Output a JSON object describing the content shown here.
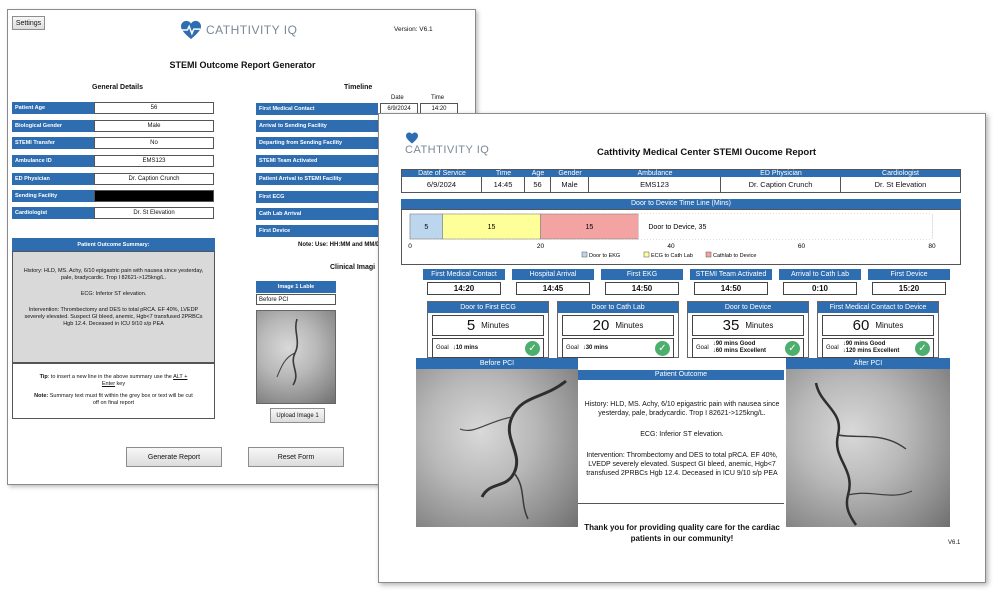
{
  "form": {
    "settings_label": "Settings",
    "brand": "CATHTIVITY IQ",
    "version": "Version: V6.1",
    "title": "STEMI Outcome Report Generator",
    "general_heading": "General Details",
    "timeline_heading": "Timeline",
    "timeline_cols": [
      "Date",
      "Time"
    ],
    "timeline_first_values": [
      "6/9/2024",
      "14:20"
    ],
    "fields": [
      {
        "label": "Patient Age",
        "value": "56"
      },
      {
        "label": "Biological Gender",
        "value": "Male"
      },
      {
        "label": "STEMI Transfer",
        "value": "No"
      },
      {
        "label": "Ambulance ID",
        "value": "EMS123"
      },
      {
        "label": "ED Physician",
        "value": "Dr. Caption Crunch"
      },
      {
        "label": "Sending Facility",
        "value": ""
      },
      {
        "label": "Cardiologist",
        "value": "Dr. St Elevation"
      }
    ],
    "timeline_items": [
      "First Medical Contact",
      "Arrival to Sending Facility",
      "Departing from Sending Facility",
      "STEMI Team Activated",
      "Patient Arrival to STEMI Facility",
      "First ECG",
      "Cath Lab Arrival",
      "First Device"
    ],
    "timeline_note": "Note: Use: HH:MM and MM/D",
    "summary_heading": "Patient Outcome Summary:",
    "summary_lines": [
      "History: HLD, MS. Achy, 6/10 epigastric pain with nausea since yesterday, pale, bradycardic. Trop I 82621->125kng/L.",
      "ECG: Inferior ST elevation.",
      "Intervention: Thrombectomy and DES to total pRCA.  EF 40%, LVEDP severely elevated.  Suspect GI bleed, anemic, Hgb<7 transfused 2PRBCs Hgb 12.4.  Deceased in ICU 9/10 s/p PEA"
    ],
    "tip_prefix": "Tip",
    "tip_text": ": to insert a new line in the above summary use the ",
    "tip_key": "ALT + Enter",
    "tip_suffix": " key",
    "note_prefix": "Note:",
    "note_text": " Summary text must fit within the grey box or text will be cut off on final report",
    "clinical_heading": "Clinical Imagi",
    "image_label_heading": "Image 1 Lable",
    "image_label_value": "Before PCI",
    "upload_button": "Upload Image 1",
    "generate_button": "Generate Report",
    "reset_button": "Reset Form"
  },
  "report": {
    "brand": "CATHTIVITY IQ",
    "title": "Cathtivity Medical Center STEMI Oucome Report",
    "info_headers": [
      "Date of Service",
      "Time",
      "Age",
      "Gender",
      "Ambulance",
      "ED Physician",
      "Cardiologist"
    ],
    "info_values": [
      "6/9/2024",
      "14:45",
      "56",
      "Male",
      "EMS123",
      "Dr. Caption Crunch",
      "Dr. St Elevation"
    ],
    "timeline_title": "Door to Device Time Line (Mins)",
    "segments": [
      {
        "label": "5",
        "value": 5,
        "color": "#bcd6ee"
      },
      {
        "label": "15",
        "value": 15,
        "color": "#ffff99"
      },
      {
        "label": "15",
        "value": 15,
        "color": "#f4a3a3"
      },
      {
        "label": "Door to Device, 35",
        "value": 45,
        "color": "#ffffff"
      }
    ],
    "axis_max": 80,
    "axis_ticks": [
      "0",
      "20",
      "40",
      "60",
      "80"
    ],
    "legend": [
      {
        "label": "Door to EKG",
        "color": "#bcd6ee"
      },
      {
        "label": "ECG to Cath Lab",
        "color": "#ffff99"
      },
      {
        "label": "Cathlab to Device",
        "color": "#f4a3a3"
      }
    ],
    "kpis": [
      {
        "label": "First Medical Contact",
        "value": "14:20"
      },
      {
        "label": "Hospital Arrival",
        "value": "14:45"
      },
      {
        "label": "First EKG",
        "value": "14:50"
      },
      {
        "label": "STEMI Team Activated",
        "value": "14:50"
      },
      {
        "label": "Arrival to Cath Lab",
        "value": "0:10"
      },
      {
        "label": "First Device",
        "value": "15:20"
      }
    ],
    "door_metrics": [
      {
        "label": "Door to First ECG",
        "value": "5",
        "unit": "Minutes",
        "goal_prefix": "Goal",
        "goal_lines": [
          "↓10 mins"
        ]
      },
      {
        "label": "Door to Cath Lab",
        "value": "20",
        "unit": "Minutes",
        "goal_prefix": "Goal",
        "goal_lines": [
          "↓30 mins"
        ]
      },
      {
        "label": "Door to Device",
        "value": "35",
        "unit": "Minutes",
        "goal_prefix": "Goal",
        "goal_lines": [
          "↓90 mins Good",
          "↓60 mins Excellent"
        ]
      },
      {
        "label": "First Medical Contact to Device",
        "value": "60",
        "unit": "Minutes",
        "goal_prefix": "Goal",
        "goal_lines": [
          "↓90 mins Good",
          "↓120 mins Excellent"
        ]
      }
    ],
    "before_label": "Before PCI",
    "after_label": "After PCI",
    "outcome_heading": "Patient Outcome",
    "outcome_lines": [
      "History: HLD, MS. Achy, 6/10 epigastric pain with nausea since yesterday, pale, bradycardic. Trop I 82621->125kng/L.",
      "ECG: Inferior ST elevation.",
      "Intervention: Thrombectomy and DES to total pRCA.  EF 40%, LVEDP severely elevated.  Suspect GI bleed, anemic, Hgb<7 transfused 2PRBCs Hgb 12.4.  Deceased in ICU 9/10 s/p PEA"
    ],
    "thanks": "Thank you for providing quality care for the cardiac patients in our community!",
    "version": "V6.1"
  },
  "colors": {
    "accent": "#2f6db1",
    "brand_heart": "#2f6db1",
    "check": "#4caf6e",
    "summary_bg": "#d9d9d9"
  },
  "icons": {
    "brand": "heart-pulse-icon",
    "check": "check-circle-icon"
  }
}
